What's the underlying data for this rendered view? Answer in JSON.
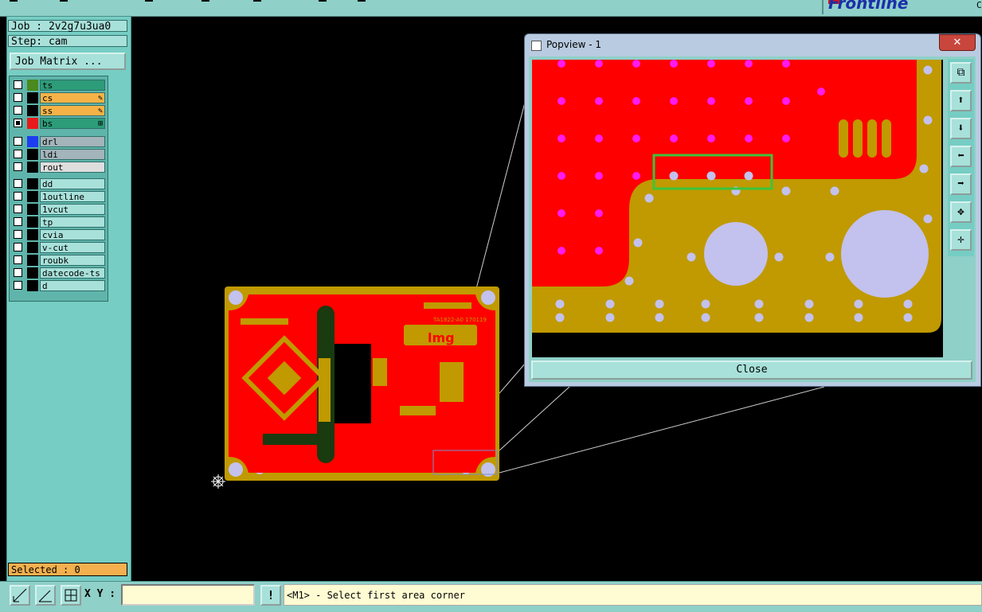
{
  "app": {
    "logo_text": "Frontline",
    "logo_sub": "C"
  },
  "job_info": {
    "job_line": "Job : 2v2g7u3ua0",
    "step_line": "Step: cam",
    "job_matrix_button": "Job Matrix ..."
  },
  "layers": {
    "group1": [
      {
        "name": "ts",
        "color": "#4a8a1e",
        "bg": "#2d9c79",
        "checked": false
      },
      {
        "name": "cs",
        "color": "#000000",
        "bg": "#f5b347",
        "checked": false,
        "edit": "✎"
      },
      {
        "name": "ss",
        "color": "#000000",
        "bg": "#f5b347",
        "checked": false,
        "edit": "✎"
      },
      {
        "name": "bs",
        "color": "#e81a1a",
        "bg": "#2d9c79",
        "checked": true,
        "edit": "⊞"
      }
    ],
    "group2": [
      {
        "name": "drl",
        "color": "#1d3df0",
        "bg": "#a3b4ba",
        "checked": false
      },
      {
        "name": "ldi",
        "color": "#000000",
        "bg": "#a3b4ba",
        "checked": false
      },
      {
        "name": "rout",
        "color": "#000000",
        "bg": "#dedede",
        "checked": false
      }
    ],
    "group3": [
      {
        "name": "dd",
        "color": "#000000",
        "bg": "#a8e1da",
        "checked": false
      },
      {
        "name": "1outline",
        "color": "#000000",
        "bg": "#a8e1da",
        "checked": false
      },
      {
        "name": "1vcut",
        "color": "#000000",
        "bg": "#a8e1da",
        "checked": false
      },
      {
        "name": "tp",
        "color": "#000000",
        "bg": "#a8e1da",
        "checked": false
      },
      {
        "name": "cvia",
        "color": "#000000",
        "bg": "#a8e1da",
        "checked": false
      },
      {
        "name": "v-cut",
        "color": "#000000",
        "bg": "#a8e1da",
        "checked": false
      },
      {
        "name": "roubk",
        "color": "#000000",
        "bg": "#a8e1da",
        "checked": false
      },
      {
        "name": "datecode-ts",
        "color": "#000000",
        "bg": "#a8e1da",
        "checked": false
      },
      {
        "name": "d",
        "color": "#000000",
        "bg": "#a8e1da",
        "checked": false
      }
    ]
  },
  "selected": "Selected : 0",
  "board": {
    "silk_label": "TA1822-A0 170119",
    "silk_logo": "lmg"
  },
  "popview": {
    "title": "Popview - 1",
    "close_x": "✕",
    "close_button": "Close",
    "tools": [
      "zoom-fit-icon",
      "arrow-up-icon",
      "arrow-down-icon",
      "arrow-left-icon",
      "arrow-right-icon",
      "zoom-in-icon",
      "zoom-out-icon"
    ]
  },
  "bottom": {
    "xy_label": "X Y :",
    "xy_value": "",
    "status_text": "<M1> - Select first area corner",
    "alert_icon": "!"
  },
  "colors": {
    "copper_red": "#ff0000",
    "board_gold": "#c09a00",
    "pad_lavender": "#c3c1ed",
    "via_magenta": "#ff1aee",
    "highlight_green": "#3cc43a",
    "panel_teal": "#8fd0c8"
  }
}
